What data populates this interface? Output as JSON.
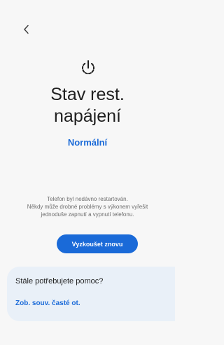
{
  "header": {
    "back_icon": "chevron-left-icon"
  },
  "main": {
    "icon": "power-restart-icon",
    "title_line1": "Stav rest.",
    "title_line2": "napájení",
    "status": "Normální",
    "description_line1": "Telefon byl nedávno restartován.",
    "description_line2": "Někdy může drobné problémy s výkonem vyřešit",
    "description_line3": "jednoduše zapnutí a vypnutí telefonu.",
    "try_again_label": "Vyzkoušet znovu"
  },
  "help": {
    "title": "Stále potřebujete pomoc?",
    "link_label": "Zob. souv. časté ot."
  },
  "colors": {
    "accent": "#1a6ad8",
    "background": "#f7f7f7",
    "card": "#e9f0f8"
  }
}
